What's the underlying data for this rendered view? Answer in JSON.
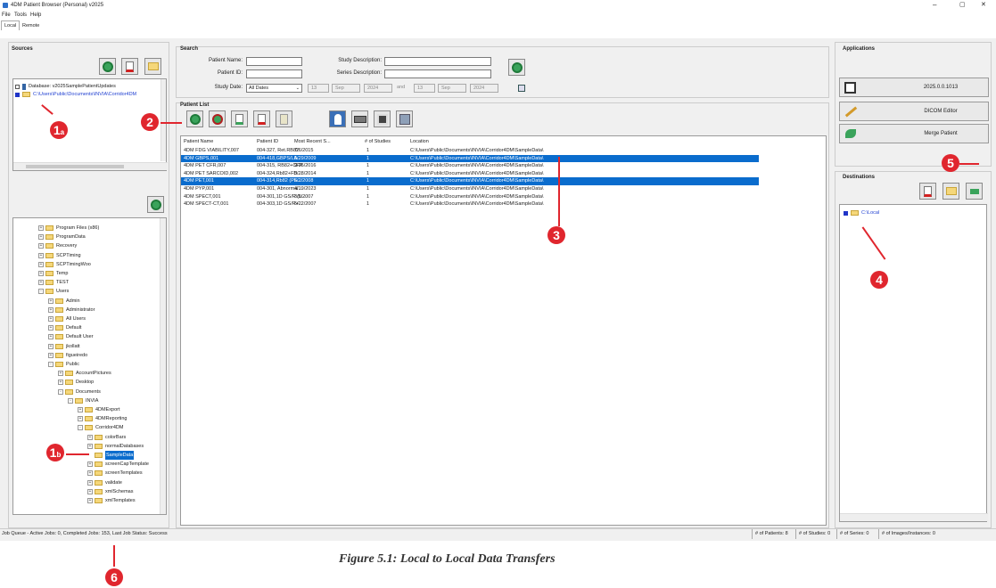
{
  "window": {
    "title": "4DM Patient Browser (Personal) v2025",
    "controls": [
      "–",
      "▢",
      "✕"
    ]
  },
  "menu": [
    "File",
    "Tools",
    "Help"
  ],
  "tabs": [
    "Local",
    "Remote"
  ],
  "sources": {
    "legend": "Sources",
    "db_label": "Database:  v2025SamplePatientUpdates",
    "db_path": "C:\\Users\\Public\\Documents\\INVIA\\Corridor4DM",
    "tree": [
      {
        "label": "Program Files (x86)",
        "depth": 0,
        "exp": "+"
      },
      {
        "label": "ProgramData",
        "depth": 0,
        "exp": "+"
      },
      {
        "label": "Recovery",
        "depth": 0,
        "exp": "+"
      },
      {
        "label": "SCPTiming",
        "depth": 0,
        "exp": "+"
      },
      {
        "label": "SCPTimingWoo",
        "depth": 0,
        "exp": "+"
      },
      {
        "label": "Temp",
        "depth": 0,
        "exp": "+"
      },
      {
        "label": "TEST",
        "depth": 0,
        "exp": "+"
      },
      {
        "label": "Users",
        "depth": 0,
        "exp": "-"
      },
      {
        "label": "Admin",
        "depth": 1,
        "exp": "+"
      },
      {
        "label": "Administrator",
        "depth": 1,
        "exp": "+"
      },
      {
        "label": "All Users",
        "depth": 1,
        "exp": "+"
      },
      {
        "label": "Default",
        "depth": 1,
        "exp": "+"
      },
      {
        "label": "Default User",
        "depth": 1,
        "exp": "+"
      },
      {
        "label": "jkollatt",
        "depth": 1,
        "exp": "+"
      },
      {
        "label": "figueiredo",
        "depth": 1,
        "exp": "+"
      },
      {
        "label": "Public",
        "depth": 1,
        "exp": "-"
      },
      {
        "label": "AccountPictures",
        "depth": 2,
        "exp": "+"
      },
      {
        "label": "Desktop",
        "depth": 2,
        "exp": "+"
      },
      {
        "label": "Documents",
        "depth": 2,
        "exp": "-"
      },
      {
        "label": "INVIA",
        "depth": 3,
        "exp": "-"
      },
      {
        "label": "4DMExport",
        "depth": 4,
        "exp": "+"
      },
      {
        "label": "4DMReporting",
        "depth": 4,
        "exp": "+"
      },
      {
        "label": "Corridor4DM",
        "depth": 4,
        "exp": "-"
      },
      {
        "label": "colorBars",
        "depth": 5,
        "exp": "+"
      },
      {
        "label": "normalDatabases",
        "depth": 5,
        "exp": "+"
      },
      {
        "label": "SampleData",
        "depth": 5,
        "exp": "",
        "selected": true
      },
      {
        "label": "screenCapTemplate",
        "depth": 5,
        "exp": "+"
      },
      {
        "label": "screenTemplates",
        "depth": 5,
        "exp": "+"
      },
      {
        "label": "validate",
        "depth": 5,
        "exp": "+"
      },
      {
        "label": "xmlSchemas",
        "depth": 5,
        "exp": "+"
      },
      {
        "label": "xmlTemplates",
        "depth": 5,
        "exp": "+"
      }
    ]
  },
  "search": {
    "legend": "Search",
    "patient_name_label": "Patient Name:",
    "patient_id_label": "Patient ID:",
    "study_date_label": "Study Date:",
    "study_date_value": "All Dates",
    "study_desc_label": "Study Description:",
    "series_desc_label": "Series Description:",
    "from_day": "13",
    "from_month": "Sep",
    "from_year": "2024",
    "and_label": "and",
    "to_day": "13",
    "to_month": "Sep",
    "to_year": "2024"
  },
  "patient_list": {
    "legend": "Patient List",
    "columns": [
      "Patient Name",
      "Patient ID",
      "Most Recent S...",
      "# of Studies",
      "Location"
    ],
    "rows": [
      {
        "name": "4DM FDG VIABILITY,007",
        "id": "004-327, Ret.RB82",
        "date": "7/6/2015",
        "n": "1",
        "loc": "C:\\Users\\Public\\Documents\\INVIA\\Corridor4DM\\SampleData\\",
        "selected": false
      },
      {
        "name": "4DM GBPS,001",
        "id": "004-418,GBPS/LA...",
        "date": "5/29/2009",
        "n": "1",
        "loc": "C:\\Users\\Public\\Documents\\INVIA\\Corridor4DM\\SampleData\\",
        "selected": true
      },
      {
        "name": "4DM PET CFR,007",
        "id": "004-315, RB82+CFR",
        "date": "9/26/2016",
        "n": "1",
        "loc": "C:\\Users\\Public\\Documents\\INVIA\\Corridor4DM\\SampleData\\",
        "selected": false
      },
      {
        "name": "4DM PET SARCOID,002",
        "id": "004-324,Rb82+FD...",
        "date": "5/28/2014",
        "n": "1",
        "loc": "C:\\Users\\Public\\Documents\\INVIA\\Corridor4DM\\SampleData\\",
        "selected": false
      },
      {
        "name": "4DM PET,001",
        "id": "004-314,Rb82 (PE...",
        "date": "5/2/2008",
        "n": "1",
        "loc": "C:\\Users\\Public\\Documents\\INVIA\\Corridor4DM\\SampleData\\",
        "selected": true
      },
      {
        "name": "4DM PYP,001",
        "id": "004-301, Abnormal...",
        "date": "4/19/2023",
        "n": "1",
        "loc": "C:\\Users\\Public\\Documents\\INVIA\\Corridor4DM\\SampleData\\",
        "selected": false
      },
      {
        "name": "4DM SPECT,001",
        "id": "004-301,1D GS/R (L...",
        "date": "3/9/2007",
        "n": "1",
        "loc": "C:\\Users\\Public\\Documents\\INVIA\\Corridor4DM\\SampleData\\",
        "selected": false
      },
      {
        "name": "4DM SPECT-CT,001",
        "id": "004-303,1D GS/R+...",
        "date": "5/22/2007",
        "n": "1",
        "loc": "C:\\Users\\Public\\Documents\\INVIA\\Corridor4DM\\SampleData\\",
        "selected": false
      }
    ]
  },
  "applications": {
    "legend": "Applications",
    "items": [
      "2025.0.0.1013",
      "DICOM Editor",
      "Merge Patient"
    ]
  },
  "destinations": {
    "legend": "Destinations",
    "local": "C:\\Local"
  },
  "status": {
    "job_queue": "Job Queue - Active Jobs: 0, Completed Jobs: 153, Last Job Status: Success",
    "patients": "# of Patients: 8",
    "studies": "# of Studies: 0",
    "series": "# of Series: 0",
    "images": "# of Images/Instances: 0"
  },
  "callouts": {
    "c1a": "1",
    "c1a_sub": "a",
    "c1b": "1",
    "c1b_sub": "b",
    "c2": "2",
    "c3": "3",
    "c4": "4",
    "c5": "5",
    "c6": "6"
  },
  "caption": "Figure 5.1: Local to Local Data Transfers",
  "colors": {
    "selection": "#0a6ccd",
    "callout": "#e0262e"
  }
}
